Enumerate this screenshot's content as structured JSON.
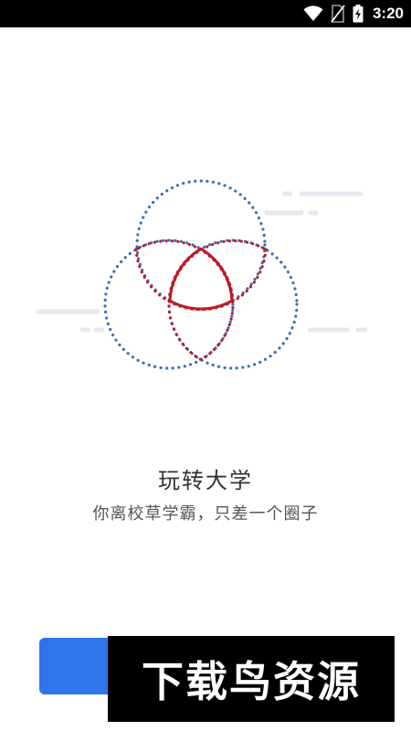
{
  "status_bar": {
    "time": "3:20",
    "icons": [
      "wifi-icon",
      "no-sim-icon",
      "battery-charging-icon"
    ]
  },
  "main": {
    "title": "玩转大学",
    "subtitle": "你离校草学霸，只差一个圈子"
  },
  "watermark": {
    "text": "下载鸟资源"
  },
  "colors": {
    "primary_blue": "#2f74e8",
    "dotted_blue": "#3d6fb3",
    "accent_red": "#c0182a",
    "speed_lines": "#e6e8ef",
    "status_bar_bg": "#000000"
  }
}
